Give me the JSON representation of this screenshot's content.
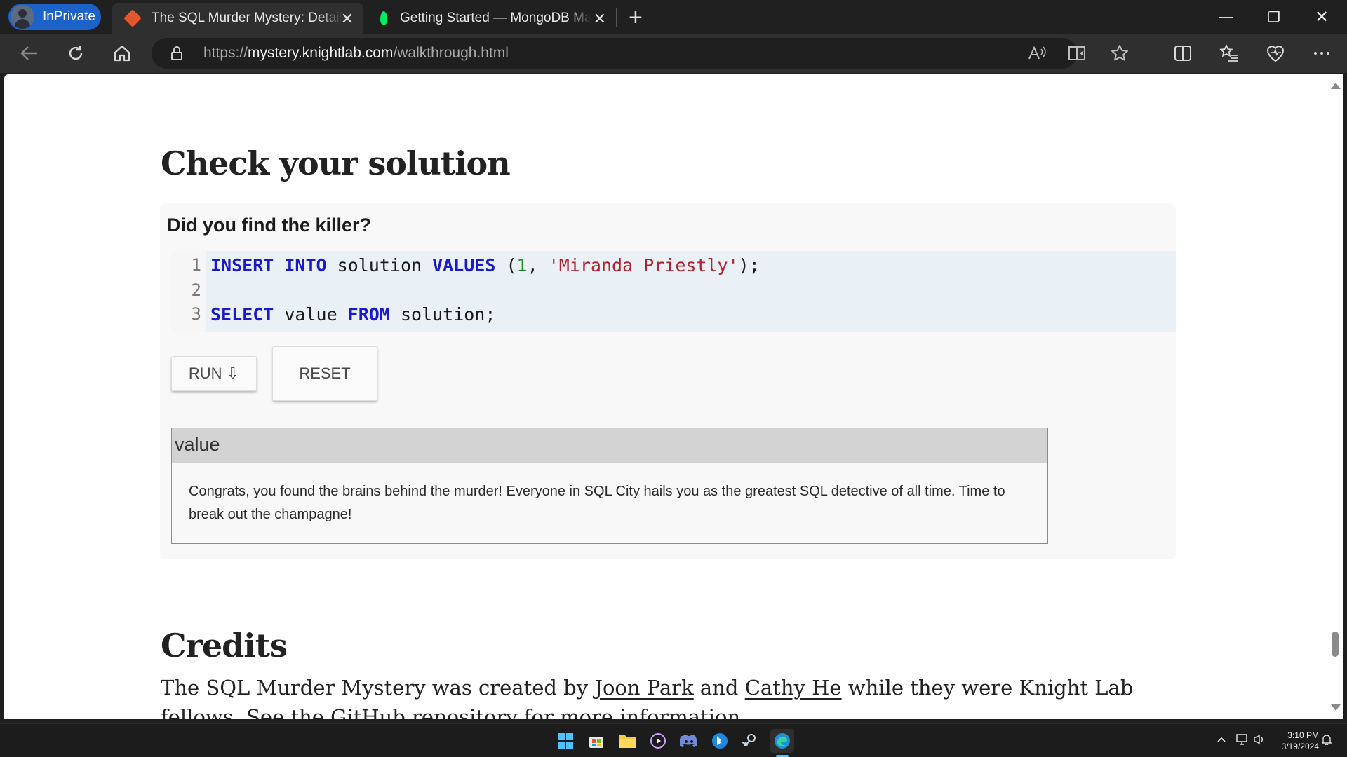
{
  "browser": {
    "inprivate_label": "InPrivate",
    "tabs": [
      {
        "title": "The SQL Murder Mystery: Detailed walkthrough",
        "active": true,
        "close": "✕"
      },
      {
        "title": "Getting Started — MongoDB Manual",
        "active": false,
        "close": "✕"
      }
    ],
    "new_tab": "+",
    "window_controls": {
      "minimize": "—",
      "restore": "❐",
      "close": "✕"
    },
    "url_prefix": "https://",
    "url_host": "mystery.knightlab.com",
    "url_path": "/walkthrough.html",
    "icons": [
      "back-icon",
      "refresh-icon",
      "home-icon",
      "lock-icon",
      "read-aloud-icon",
      "immersive-reader-icon",
      "favorite-star-icon",
      "split-screen-icon",
      "favorites-icon",
      "browser-essentials-icon",
      "more-icon"
    ]
  },
  "page": {
    "check_heading": "Check your solution",
    "card_title": "Did you find the killer?",
    "code_lines": [
      {
        "num": "1"
      },
      {
        "num": "2"
      },
      {
        "num": "3"
      }
    ],
    "code": {
      "l1_kw1": "INSERT",
      "l1_kw2": "INTO",
      "l1_t1": " solution ",
      "l1_kw3": "VALUES",
      "l1_t2": " (",
      "l1_num": "1",
      "l1_t3": ", ",
      "l1_str": "'Miranda Priestly'",
      "l1_t4": ");",
      "l3_kw1": "SELECT",
      "l3_t1": " value ",
      "l3_kw2": "FROM",
      "l3_t2": " solution;"
    },
    "run_button": "RUN ⇩",
    "reset_button": "RESET",
    "result_header": "value",
    "result_value": "Congrats, you found the brains behind the murder! Everyone in SQL City hails you as the greatest SQL detective of all time. Time to break out the champagne!",
    "credits_heading": "Credits",
    "credits_p1": "The SQL Murder Mystery was created by ",
    "credits_link1": "Joon Park",
    "credits_p2": " and ",
    "credits_link2": "Cathy He",
    "credits_p3": " while they were Knight Lab fellows. See the GitHub repository for more information."
  },
  "taskbar": {
    "apps": [
      "windows-start-icon",
      "store-icon",
      "file-explorer-icon",
      "media-player-icon",
      "discord-icon",
      "bing-icon",
      "steam-icon",
      "edge-icon"
    ],
    "time": "3:10 PM",
    "date": "3/19/2024"
  },
  "colors": {
    "tab_active": "#2f2f2f",
    "inprivate_pill": "#1c62c9",
    "sql_keyword": "#1a1acc",
    "sql_string": "#b3212e",
    "sql_number": "#1b8a2e",
    "code_bg": "#e9f1f6"
  }
}
